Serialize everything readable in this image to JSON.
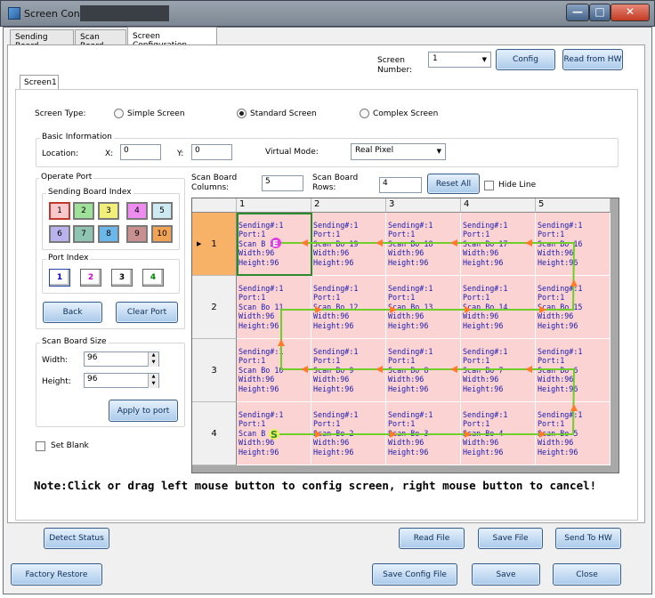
{
  "window": {
    "title": "Screen Config"
  },
  "tabs": [
    "Sending Board",
    "Scan Board",
    "Screen Configuration"
  ],
  "inner_tab": "Screen1",
  "screen_number": {
    "label": "Screen\nNumber:",
    "value": "1"
  },
  "buttons": {
    "config": "Config",
    "read_from_hw": "Read from HW",
    "reset_all": "Reset All",
    "back": "Back",
    "clear_port": "Clear Port",
    "apply_to_port": "Apply to port",
    "detect_status": "Detect Status",
    "read_file": "Read File",
    "save_file": "Save File",
    "send_to_hw": "Send To HW",
    "factory_restore": "Factory Restore",
    "save_config_file": "Save Config File",
    "save": "Save",
    "close": "Close"
  },
  "screen_type": {
    "label": "Screen Type:",
    "options": [
      "Simple Screen",
      "Standard Screen",
      "Complex Screen"
    ],
    "selected": "Standard Screen"
  },
  "basic_info": {
    "title": "Basic Information",
    "location_label": "Location:",
    "x_label": "X:",
    "x_value": "0",
    "y_label": "Y:",
    "y_value": "0",
    "virtual_mode_label": "Virtual Mode:",
    "virtual_mode_value": "Real Pixel"
  },
  "operate_port": {
    "title": "Operate Port",
    "sending_board_index_title": "Sending Board Index",
    "sending_boards": [
      {
        "label": "1",
        "color": "#f9c8cc"
      },
      {
        "label": "2",
        "color": "#9fe09a"
      },
      {
        "label": "3",
        "color": "#f1ee7a"
      },
      {
        "label": "4",
        "color": "#ee8cf0"
      },
      {
        "label": "5",
        "color": "#cdeaf3"
      },
      {
        "label": "6",
        "color": "#b9b2ec"
      },
      {
        "label": "7",
        "color": "#8fc4b3"
      },
      {
        "label": "8",
        "color": "#6bb7ea"
      },
      {
        "label": "9",
        "color": "#c99090"
      },
      {
        "label": "10",
        "color": "#f0a354"
      }
    ],
    "port_index_title": "Port Index",
    "ports": [
      {
        "label": "1",
        "color": "#0000cc"
      },
      {
        "label": "2",
        "color": "#cc00cc"
      },
      {
        "label": "3",
        "color": "#000000"
      },
      {
        "label": "4",
        "color": "#008800"
      }
    ]
  },
  "scan_board_size": {
    "title": "Scan Board Size",
    "width_label": "Width:",
    "width_value": "96",
    "height_label": "Height:",
    "height_value": "96"
  },
  "set_blank_label": "Set Blank",
  "scan_board_columns": {
    "label": "Scan Board\nColumns:",
    "value": "5"
  },
  "scan_board_rows": {
    "label": "Scan Board\nRows:",
    "value": "4"
  },
  "hide_line_label": "Hide Line",
  "grid": {
    "col_headers": [
      "1",
      "2",
      "3",
      "4",
      "5"
    ],
    "row_headers": [
      "1",
      "2",
      "3",
      "4"
    ],
    "selected_row": "1",
    "cells": [
      [
        "Sending#:1\nPort:1\nScan B 20\nWidth:96\nHeight:96",
        "Sending#:1\nPort:1\nScan Bo 19\nWidth:96\nHeight:96",
        "Sending#:1\nPort:1\nScan Bo 18\nWidth:96\nHeight:96",
        "Sending#:1\nPort:1\nScan Bo 17\nWidth:96\nHeight:96",
        "Sending#:1\nPort:1\nScan Bo 16\nWidth:96\nHeight:96"
      ],
      [
        "Sending#:1\nPort:1\nScan Bo 11\nWidth:96\nHeight:96",
        "Sending#:1\nPort:1\nScan Bo 12\nWidth:96\nHeight:96",
        "Sending#:1\nPort:1\nScan Bo 13\nWidth:96\nHeight:96",
        "Sending#:1\nPort:1\nScan Bo 14\nWidth:96\nHeight:96",
        "Sending#:1\nPort:1\nScan Bo 15\nWidth:96\nHeight:96"
      ],
      [
        "Sending#:1\nPort:1\nScan Bo 10\nWidth:96\nHeight:96",
        "Sending#:1\nPort:1\nScan Bo 9\nWidth:96\nHeight:96",
        "Sending#:1\nPort:1\nScan Bo 8\nWidth:96\nHeight:96",
        "Sending#:1\nPort:1\nScan Bo 7\nWidth:96\nHeight:96",
        "Sending#:1\nPort:1\nScan Bo 6\nWidth:96\nHeight:96"
      ],
      [
        "Sending#:1\nPort:1\nScan B 1\nWidth:96\nHeight:96",
        "Sending#:1\nPort:1\nScan Bo 2\nWidth:96\nHeight:96",
        "Sending#:1\nPort:1\nScan Bo 3\nWidth:96\nHeight:96",
        "Sending#:1\nPort:1\nScan Bo 4\nWidth:96\nHeight:96",
        "Sending#:1\nPort:1\nScan Bo 5\nWidth:96\nHeight:96"
      ]
    ],
    "start_marker": "S",
    "end_marker": "E"
  },
  "note": "Note:Click or drag left mouse button to config screen, right mouse button to cancel!",
  "colors": {
    "cell_bg": "#fcd3d3",
    "selected_row_header": "#f7b268",
    "path_line": "#6fcf28",
    "arrow": "#ff7a2a",
    "cell_text": "#1a1ab0"
  }
}
